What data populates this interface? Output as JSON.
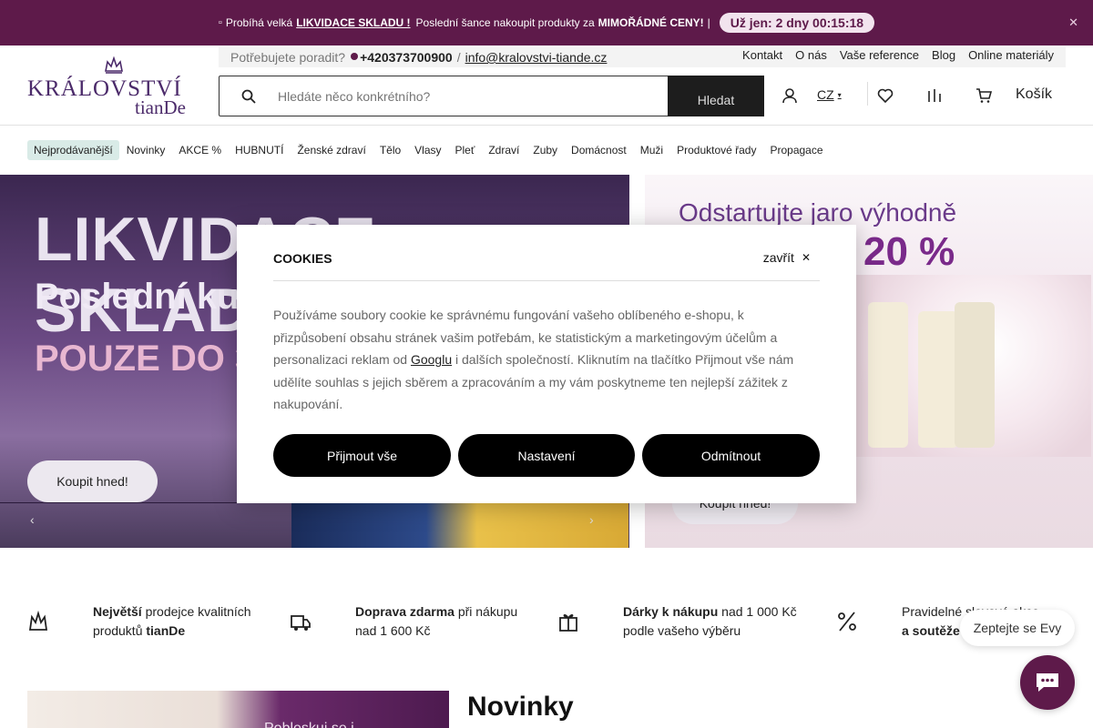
{
  "promo": {
    "prefix_icon": "box-icon",
    "text1": "Probíhá velká",
    "link": "LIKVIDACE SKLADU !",
    "text2": "Poslední šance nakoupit produkty za",
    "bold": "MIMOŘÁDNÉ CENY!",
    "separator": "|",
    "timer": "Už jen: 2 dny 00:15:18",
    "close_icon": "close-icon"
  },
  "header": {
    "logo_line1": "KRÁLOVSTVÍ",
    "logo_line2": "tianDe",
    "help_label": "Potřebujete poradit?",
    "phone": "+420373700900",
    "slash": "/",
    "email": "info@kralovstvi-tiande.cz",
    "top_links": [
      "Kontakt",
      "O nás",
      "Vaše reference",
      "Blog",
      "Online materiály"
    ],
    "search_placeholder": "Hledáte něco konkrétního?",
    "search_button": "Hledat",
    "language": "CZ",
    "cart_label": "Košík"
  },
  "nav": {
    "items": [
      "Nejprodávanější",
      "Novinky",
      "AKCE %",
      "HUBNUTÍ",
      "Ženské zdraví",
      "Tělo",
      "Vlasy",
      "Pleť",
      "Zdraví",
      "Zuby",
      "Domácnost",
      "Muži",
      "Produktové řady",
      "Propagace"
    ]
  },
  "banner_left": {
    "title1": "LIKVIDACE SKLADU",
    "title2": "Poslední ku",
    "title3": "POUZE DO 3",
    "button": "Koupit hned!"
  },
  "banner_right": {
    "title1": "Odstartujte jaro výhodně",
    "title2": "20 %",
    "button": "Koupit hned!"
  },
  "usps": [
    {
      "bold1": "Největší",
      "text1": " prodejce kvalitních",
      "text2": "produktů ",
      "bold2": "tianDe"
    },
    {
      "bold1": "Doprava zdarma",
      "text1": " při nákupu",
      "text2": "nad 1 600 Kč",
      "bold2": ""
    },
    {
      "bold1": "Dárky k nákupu",
      "text1": " nad 1 000 Kč",
      "text2": "podle vašeho výběru",
      "bold2": ""
    },
    {
      "bold1": "",
      "text1": "Pravidelné slevové akce",
      "text2": "a soutěže",
      "bold2": ""
    }
  ],
  "section": {
    "title": "Novinky",
    "image_caption": "Pobleskuj se i ..."
  },
  "chat": {
    "bubble": "Zeptejte se Evy"
  },
  "cookies": {
    "title": "COOKIES",
    "close": "zavřít",
    "body_before": "Používáme soubory cookie ke správnému fungování vašeho oblíbeného e-shopu, k přizpůsobení obsahu stránek vašim potřebám, ke statistickým a marketingovým účelům a personalizaci reklam od ",
    "body_link": "Googlu",
    "body_after": " i dalších společností. Kliknutím na tlačítko Přijmout vše nám udělíte souhlas s jejich sběrem a zpracováním a my vám poskytneme ten nejlepší zážitek z nakupování.",
    "accept": "Přijmout vše",
    "settings": "Nastavení",
    "reject": "Odmítnout"
  }
}
